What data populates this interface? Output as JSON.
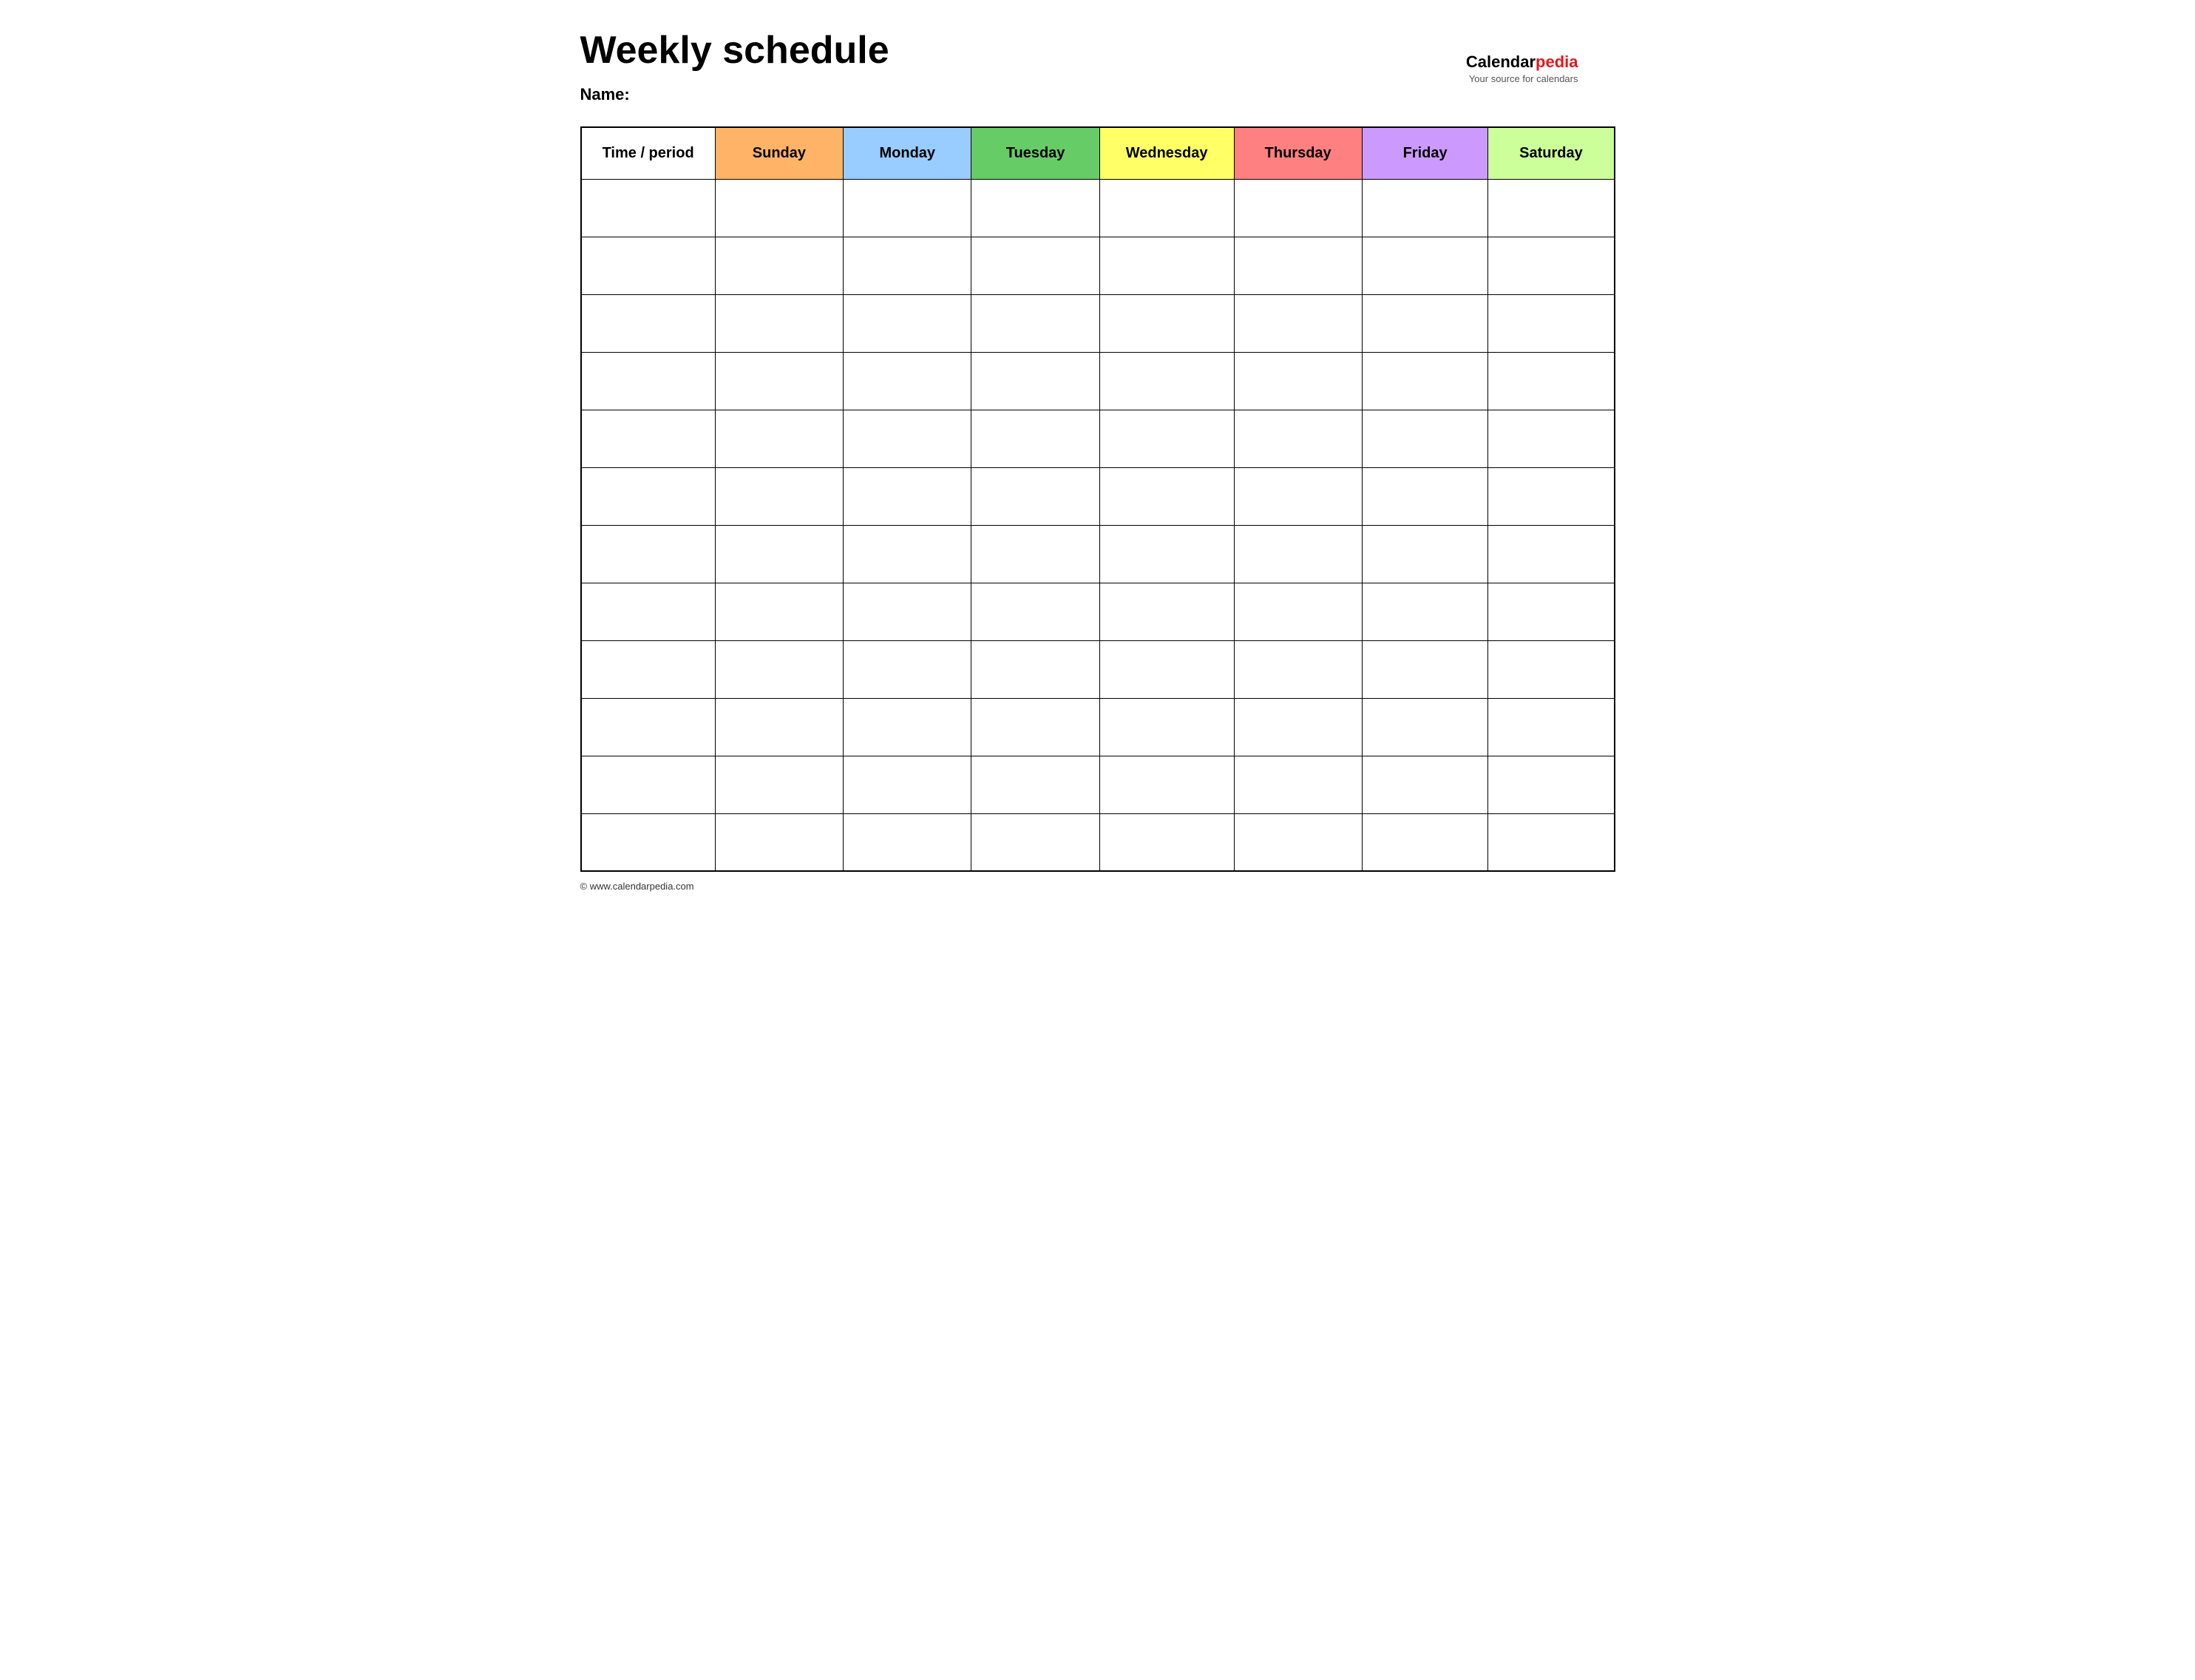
{
  "page": {
    "title": "Weekly schedule",
    "name_label": "Name:",
    "footer_url": "© www.calendarpedia.com"
  },
  "brand": {
    "calendar": "Calendar",
    "pedia": "pedia",
    "tagline": "Your source for calendars"
  },
  "table": {
    "headers": [
      {
        "label": "Time / period",
        "color": "#ffffff",
        "class": "col-time"
      },
      {
        "label": "Sunday",
        "color": "#ffb366",
        "class": "col-sunday"
      },
      {
        "label": "Monday",
        "color": "#99ccff",
        "class": "col-monday"
      },
      {
        "label": "Tuesday",
        "color": "#66cc66",
        "class": "col-tuesday"
      },
      {
        "label": "Wednesday",
        "color": "#ffff55",
        "class": "col-wednesday"
      },
      {
        "label": "Thursday",
        "color": "#ff8080",
        "class": "col-thursday"
      },
      {
        "label": "Friday",
        "color": "#cc99ff",
        "class": "col-friday"
      },
      {
        "label": "Saturday",
        "color": "#ccff99",
        "class": "col-saturday"
      }
    ],
    "row_count": 12
  }
}
